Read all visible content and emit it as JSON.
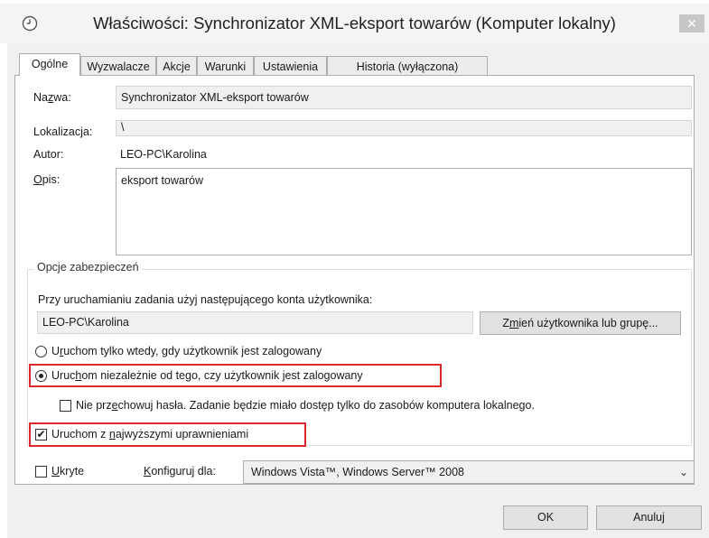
{
  "window": {
    "title": "Właściwości: Synchronizator XML-eksport towarów (Komputer lokalny)",
    "close_glyph": "✕",
    "icon": "clock-icon"
  },
  "tabs": [
    {
      "label": "Ogólne",
      "active": true
    },
    {
      "label": "Wyzwalacze",
      "active": false
    },
    {
      "label": "Akcje",
      "active": false
    },
    {
      "label": "Warunki",
      "active": false
    },
    {
      "label": "Ustawienia",
      "active": false
    },
    {
      "label": "Historia (wyłączona)",
      "active": false
    }
  ],
  "general": {
    "name_label_pre": "Na",
    "name_label_u": "z",
    "name_label_post": "wa:",
    "name_value": "Synchronizator XML-eksport towarów",
    "location_label": "Lokalizacja:",
    "location_value": "\\",
    "author_label": "Autor:",
    "author_value": "LEO-PC\\Karolina",
    "description_label_u": "O",
    "description_label_post": "pis:",
    "description_value": "eksport towarów"
  },
  "security": {
    "legend": "Opcje zabezpieczeń",
    "account_prompt": "Przy uruchamianiu zadania użyj następującego konta użytkownika:",
    "account_value": "LEO-PC\\Karolina",
    "change_user_pre": "Z",
    "change_user_u": "m",
    "change_user_post": "ień użytkownika lub grupę...",
    "radio1_pre": "U",
    "radio1_u": "r",
    "radio1_post": "uchom tylko wtedy, gdy użytkownik jest zalogowany",
    "radio1_selected": false,
    "radio2_pre": "Uruc",
    "radio2_u": "h",
    "radio2_post": "om niezależnie od tego, czy użytkownik jest zalogowany",
    "radio2_selected": true,
    "nostore_pre": "Nie prz",
    "nostore_u": "e",
    "nostore_post": "chowuj hasła. Zadanie będzie miało dostęp tylko do zasobów komputera lokalnego.",
    "nostore_checked": false,
    "highest_pre": "Uruchom z ",
    "highest_u": "n",
    "highest_post": "ajwyższymi uprawnieniami",
    "highest_checked": true,
    "highlight_color": "#d9272a"
  },
  "footer": {
    "hidden_u": "U",
    "hidden_post": "kryte",
    "hidden_checked": false,
    "configure_u": "K",
    "configure_post": "onfiguruj dla:",
    "configure_value": "Windows Vista™, Windows Server™ 2008",
    "ok_label": "OK",
    "cancel_label": "Anuluj"
  }
}
